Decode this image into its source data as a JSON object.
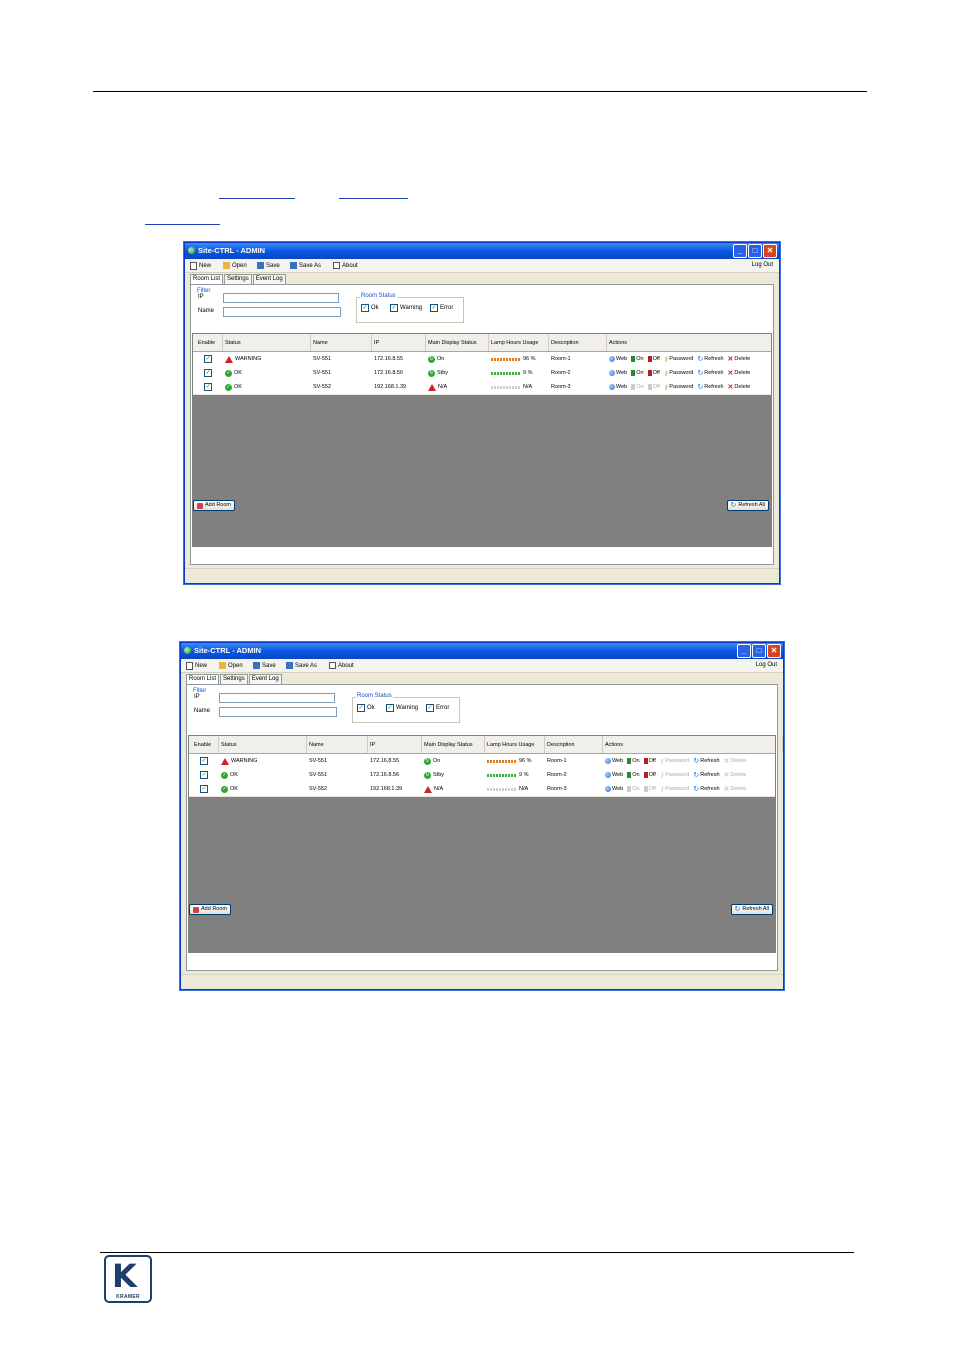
{
  "brand": {
    "logo_text": "KRAMER",
    "accent": "#1a3f6e"
  },
  "windows": [
    {
      "title": "Site-CTRL - ADMIN",
      "toolbar": {
        "new": "New",
        "open": "Open",
        "save": "Save",
        "save_as": "Save As",
        "about": "About",
        "logout": "Log Out"
      },
      "tabs": [
        "Room List",
        "Settings",
        "Event Log"
      ],
      "filter": {
        "legend": "Filter",
        "ip_label": "IP",
        "ip_value": ". . .",
        "name_label": "Name"
      },
      "room_status": {
        "legend": "Room Status",
        "ok": "Ok",
        "warning": "Warning",
        "error": "Error"
      },
      "columns": [
        "Enable",
        "Status",
        "Name",
        "IP",
        "Main Display Status",
        "Lamp Hours Usage",
        "Description",
        "Actions"
      ],
      "actions": {
        "web": "Web",
        "on": "On",
        "off": "Off",
        "password": "Password",
        "refresh": "Refresh",
        "delete": "Delete"
      },
      "rows": [
        {
          "status": "WARNING",
          "name": "SV-551",
          "ip": "172.16.8.55",
          "display": "On",
          "lamp_pct": 96,
          "lamp_text": "96 %",
          "desc": "Room-1"
        },
        {
          "status": "OK",
          "name": "SV-551",
          "ip": "172.16.8.56",
          "display": "Stby",
          "lamp_pct": 9,
          "lamp_text": "9 %",
          "desc": "Room-2"
        },
        {
          "status": "OK",
          "name": "SV-552",
          "ip": "192.168.1.39",
          "display": "N/A",
          "lamp_pct": 0,
          "lamp_text": "N/A",
          "desc": "Room-3"
        }
      ],
      "add_room": "Add Room",
      "refresh_all": "Refresh All"
    },
    {
      "title": "Site-CTRL - ADMIN",
      "toolbar": {
        "new": "New",
        "open": "Open",
        "save": "Save",
        "save_as": "Save As",
        "about": "About",
        "logout": "Log Out"
      },
      "tabs": [
        "Room List",
        "Settings",
        "Event Log"
      ],
      "filter": {
        "legend": "Filter",
        "ip_label": "IP",
        "ip_value": ". . .",
        "name_label": "Name"
      },
      "room_status": {
        "legend": "Room Status",
        "ok": "Ok",
        "warning": "Warning",
        "error": "Error"
      },
      "columns": [
        "Enable",
        "Status",
        "Name",
        "IP",
        "Main Display Status",
        "Lamp Hours Usage",
        "Description",
        "Actions"
      ],
      "actions": {
        "web": "Web",
        "on": "On",
        "off": "Off",
        "password": "Password",
        "refresh": "Refresh",
        "delete": "Delete"
      },
      "rows": [
        {
          "status": "WARNING",
          "name": "SV-551",
          "ip": "172.16.8.55",
          "display": "On",
          "lamp_pct": 96,
          "lamp_text": "96 %",
          "desc": "Room-1"
        },
        {
          "status": "OK",
          "name": "SV-551",
          "ip": "172.16.8.56",
          "display": "Stby",
          "lamp_pct": 9,
          "lamp_text": "9 %",
          "desc": "Room-2"
        },
        {
          "status": "OK",
          "name": "SV-552",
          "ip": "192.168.1.39",
          "display": "N/A",
          "lamp_pct": 0,
          "lamp_text": "N/A",
          "desc": "Room-3"
        }
      ],
      "add_room": "Add Room",
      "refresh_all": "Refresh All"
    }
  ]
}
